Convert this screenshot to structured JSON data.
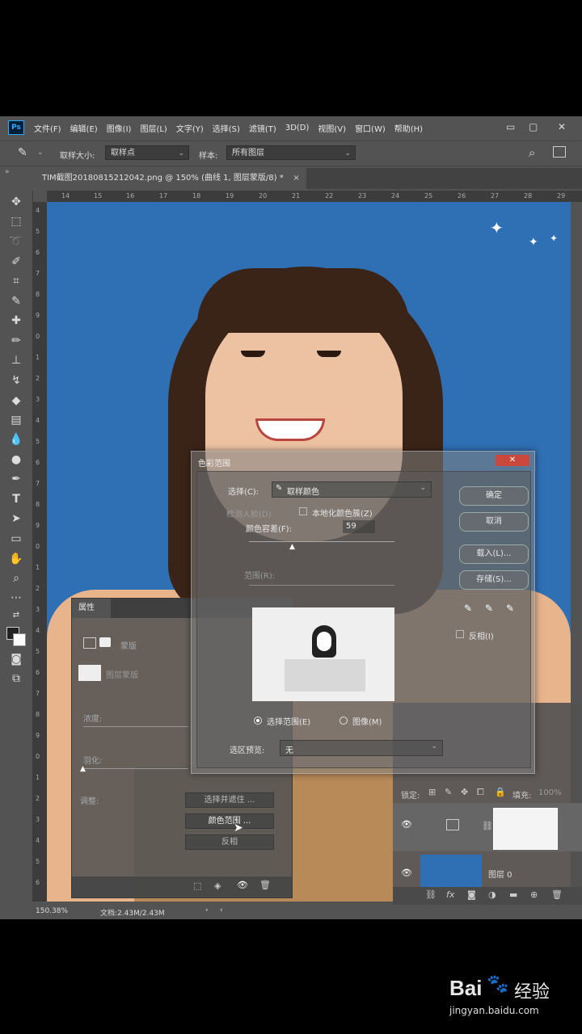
{
  "app": {
    "logo": "Ps"
  },
  "menu": [
    "文件(F)",
    "编辑(E)",
    "图像(I)",
    "图层(L)",
    "文字(Y)",
    "选择(S)",
    "滤镜(T)",
    "3D(D)",
    "视图(V)",
    "窗口(W)",
    "帮助(H)"
  ],
  "window_controls": {
    "minimize": "▭",
    "restore": "▢",
    "close": "✕"
  },
  "options": {
    "sample_size_label": "取样大小:",
    "sample_size_value": "取样点",
    "sample_label": "样本:",
    "sample_value": "所有图层"
  },
  "document": {
    "tab_title": "TIM截图20180815212042.png @ 150% (曲线 1, 图层蒙版/8) *",
    "tab_close": "×"
  },
  "rulers": {
    "top": [
      "14",
      "15",
      "16",
      "17",
      "18",
      "19",
      "20",
      "21",
      "22",
      "23",
      "24",
      "25",
      "26",
      "27",
      "28",
      "29"
    ],
    "left": [
      "4",
      "5",
      "6",
      "7",
      "8",
      "9",
      "0",
      "1",
      "2",
      "3",
      "4",
      "5",
      "6",
      "7",
      "8",
      "9",
      "0",
      "1",
      "2",
      "3",
      "4",
      "5",
      "6",
      "7",
      "8",
      "9",
      "0",
      "1",
      "2",
      "3",
      "4",
      "5",
      "6"
    ]
  },
  "status": {
    "zoom": "150.38%",
    "doc_size": "文档:2.43M/2.43M"
  },
  "properties": {
    "tab": "属性",
    "type_label": "蒙版",
    "mask_label": "图层蒙版",
    "density_label": "浓度:",
    "feather_label": "羽化:",
    "adjust_label": "调整:",
    "select_and_mask": "选择并遮住 ...",
    "color_range": "颜色范围 ...",
    "invert": "反相"
  },
  "dialog": {
    "title": "色彩范围",
    "close": "✕",
    "select_label": "选择(C):",
    "select_value": "取样颜色",
    "detect_faces": "检测人脸(D)",
    "localized": "本地化颜色簇(Z)",
    "fuzziness_label": "颜色容差(F):",
    "fuzziness_value": "59",
    "range_label": "范围(R):",
    "ok": "确定",
    "cancel": "取消",
    "load": "载入(L)...",
    "save": "存储(S)...",
    "invert": "反相(I)",
    "radio_selection": "选择范围(E)",
    "radio_image": "图像(M)",
    "preview_label": "选区预览:",
    "preview_value": "无"
  },
  "layers": {
    "lock_label": "锁定:",
    "fill_label": "填充:",
    "fill_value": "100%",
    "layer0_name": "图层 0"
  },
  "watermark": {
    "brand": "Bai",
    "brand2": "经验",
    "url": "jingyan.baidu.com"
  }
}
